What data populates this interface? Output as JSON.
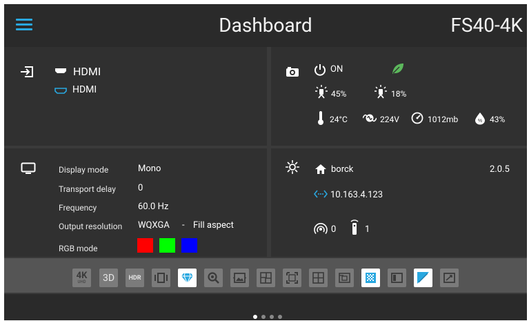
{
  "header": {
    "title": "Dashboard",
    "model": "FS40-4K"
  },
  "source": {
    "input1": "HDMI",
    "input2": "HDMI"
  },
  "status": {
    "power": "ON",
    "lamp1": "45%",
    "lamp2": "18%",
    "temperature": "24°C",
    "voltage": "224V",
    "pressure": "1012mb",
    "humidity": "43%",
    "eco_color": "#5cb85c"
  },
  "display": {
    "rows": [
      {
        "label": "Display mode",
        "value": "Mono"
      },
      {
        "label": "Transport delay",
        "value": "0"
      },
      {
        "label": "Frequency",
        "value": "60.0 Hz"
      },
      {
        "label": "Output resolution",
        "value": "WQXGA",
        "sep": "-",
        "extra": "Fill aspect"
      },
      {
        "label": "RGB mode"
      }
    ],
    "rgb_colors": [
      "#ff0000",
      "#00ff00",
      "#0000ff"
    ]
  },
  "network": {
    "hostname": "borck",
    "version": "2.0.5",
    "ip": "10.163.4.123",
    "wireless_count": "0",
    "remote_count": "1",
    "accent": "#29a8e0"
  },
  "toolbar": {
    "items": [
      {
        "name": "4k-uhd-icon",
        "text": "4K",
        "sub": "UHD"
      },
      {
        "name": "3d-icon",
        "text": "3D"
      },
      {
        "name": "hdr-icon",
        "text": "HDR"
      },
      {
        "name": "warp-icon"
      },
      {
        "name": "diamond-icon",
        "active": true
      },
      {
        "name": "zoom-icon"
      },
      {
        "name": "image-adjust-icon"
      },
      {
        "name": "blend-icon"
      },
      {
        "name": "border-icon"
      },
      {
        "name": "grid-icon"
      },
      {
        "name": "pip-icon"
      },
      {
        "name": "pattern-icon",
        "active": true
      },
      {
        "name": "panel-icon"
      },
      {
        "name": "gradient-icon",
        "active": true
      },
      {
        "name": "ratio-icon"
      }
    ]
  },
  "pager": {
    "pages": 4,
    "current": 0
  }
}
